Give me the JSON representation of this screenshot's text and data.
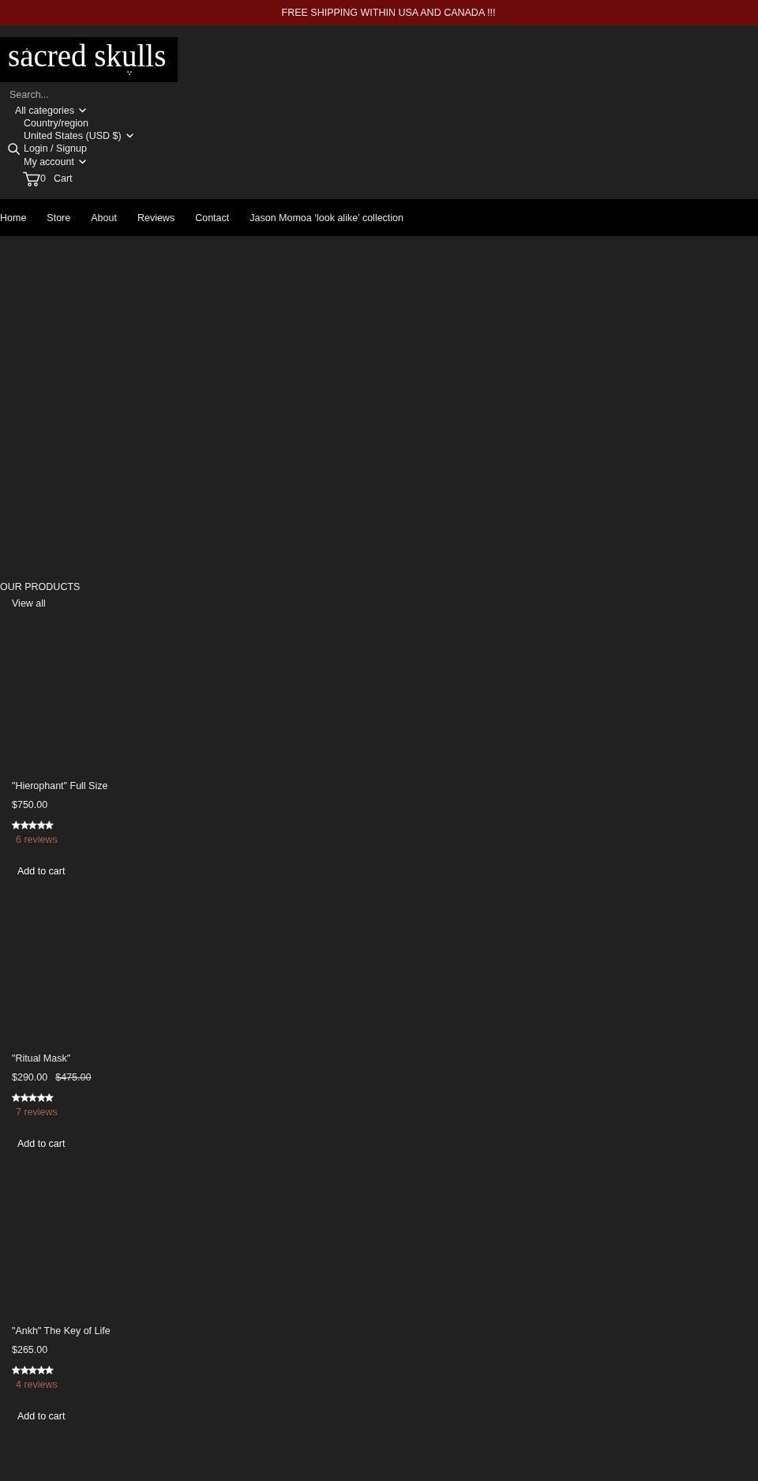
{
  "announcement": {
    "text": "FREE SHIPPING WITHIN USA AND CANADA !!!"
  },
  "header": {
    "logo": "sacred skulls",
    "search": {
      "placeholder": "Search...",
      "category": "All categories"
    },
    "country": {
      "label": "Country/region",
      "value": "United States (USD $)"
    },
    "account": {
      "login": "Login / Signup",
      "menu": "My account"
    },
    "cart": {
      "count": "0",
      "label": "Cart"
    }
  },
  "nav": {
    "items": [
      "Home",
      "Store",
      "About",
      "Reviews",
      "Contact",
      "Jason Momoa ‘look alike’ collection"
    ]
  },
  "products_section": {
    "title": "OUR PRODUCTS",
    "view_all": "View all",
    "products": [
      {
        "title": "\"Hierophant\" Full Size",
        "price": "$750.00",
        "stars": 5,
        "reviews": "6 reviews",
        "button": "Add to cart"
      },
      {
        "title": "\"Ritual Mask\"",
        "price": "$290.00",
        "compare_at_price": "$475.00",
        "stars": 5,
        "reviews": "7 reviews",
        "button": "Add to cart"
      },
      {
        "title": "\"Ankh\" The Key of Life",
        "price": "$265.00",
        "stars": 5,
        "reviews": "4 reviews",
        "button": "Add to cart"
      }
    ]
  }
}
